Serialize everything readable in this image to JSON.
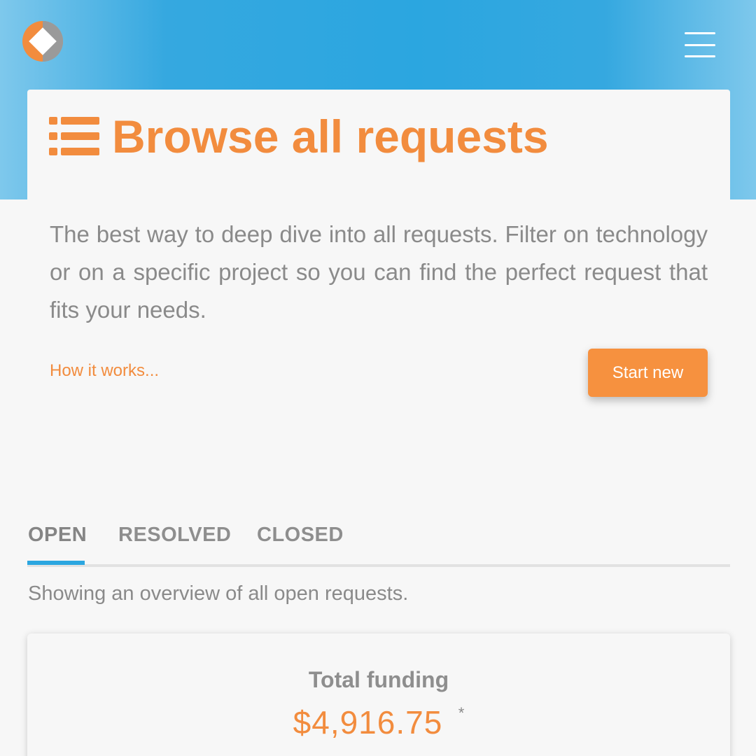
{
  "header": {
    "logo_icon": "diamond-logo-icon",
    "menu_icon": "hamburger-menu-icon"
  },
  "hero": {
    "icon": "list-icon",
    "title": "Browse all requests",
    "description": "The best way to deep dive into all requests. Filter on technology or on a specific project so you can find the perfect request that fits your needs.",
    "how_it_works": "How it works...",
    "start_new": "Start new"
  },
  "tabs": {
    "items": [
      {
        "label": "OPEN"
      },
      {
        "label": "RESOLVED"
      },
      {
        "label": "CLOSED"
      }
    ],
    "active": "OPEN",
    "caption": "Showing an overview of all open requests."
  },
  "funding": {
    "label": "Total funding",
    "amount": "$4,916.75",
    "asterisk": "*"
  },
  "colors": {
    "accent_orange": "#f28c3e",
    "accent_blue": "#2ba6e0",
    "background": "#f7f7f7",
    "text_gray": "#8a8a8a"
  }
}
